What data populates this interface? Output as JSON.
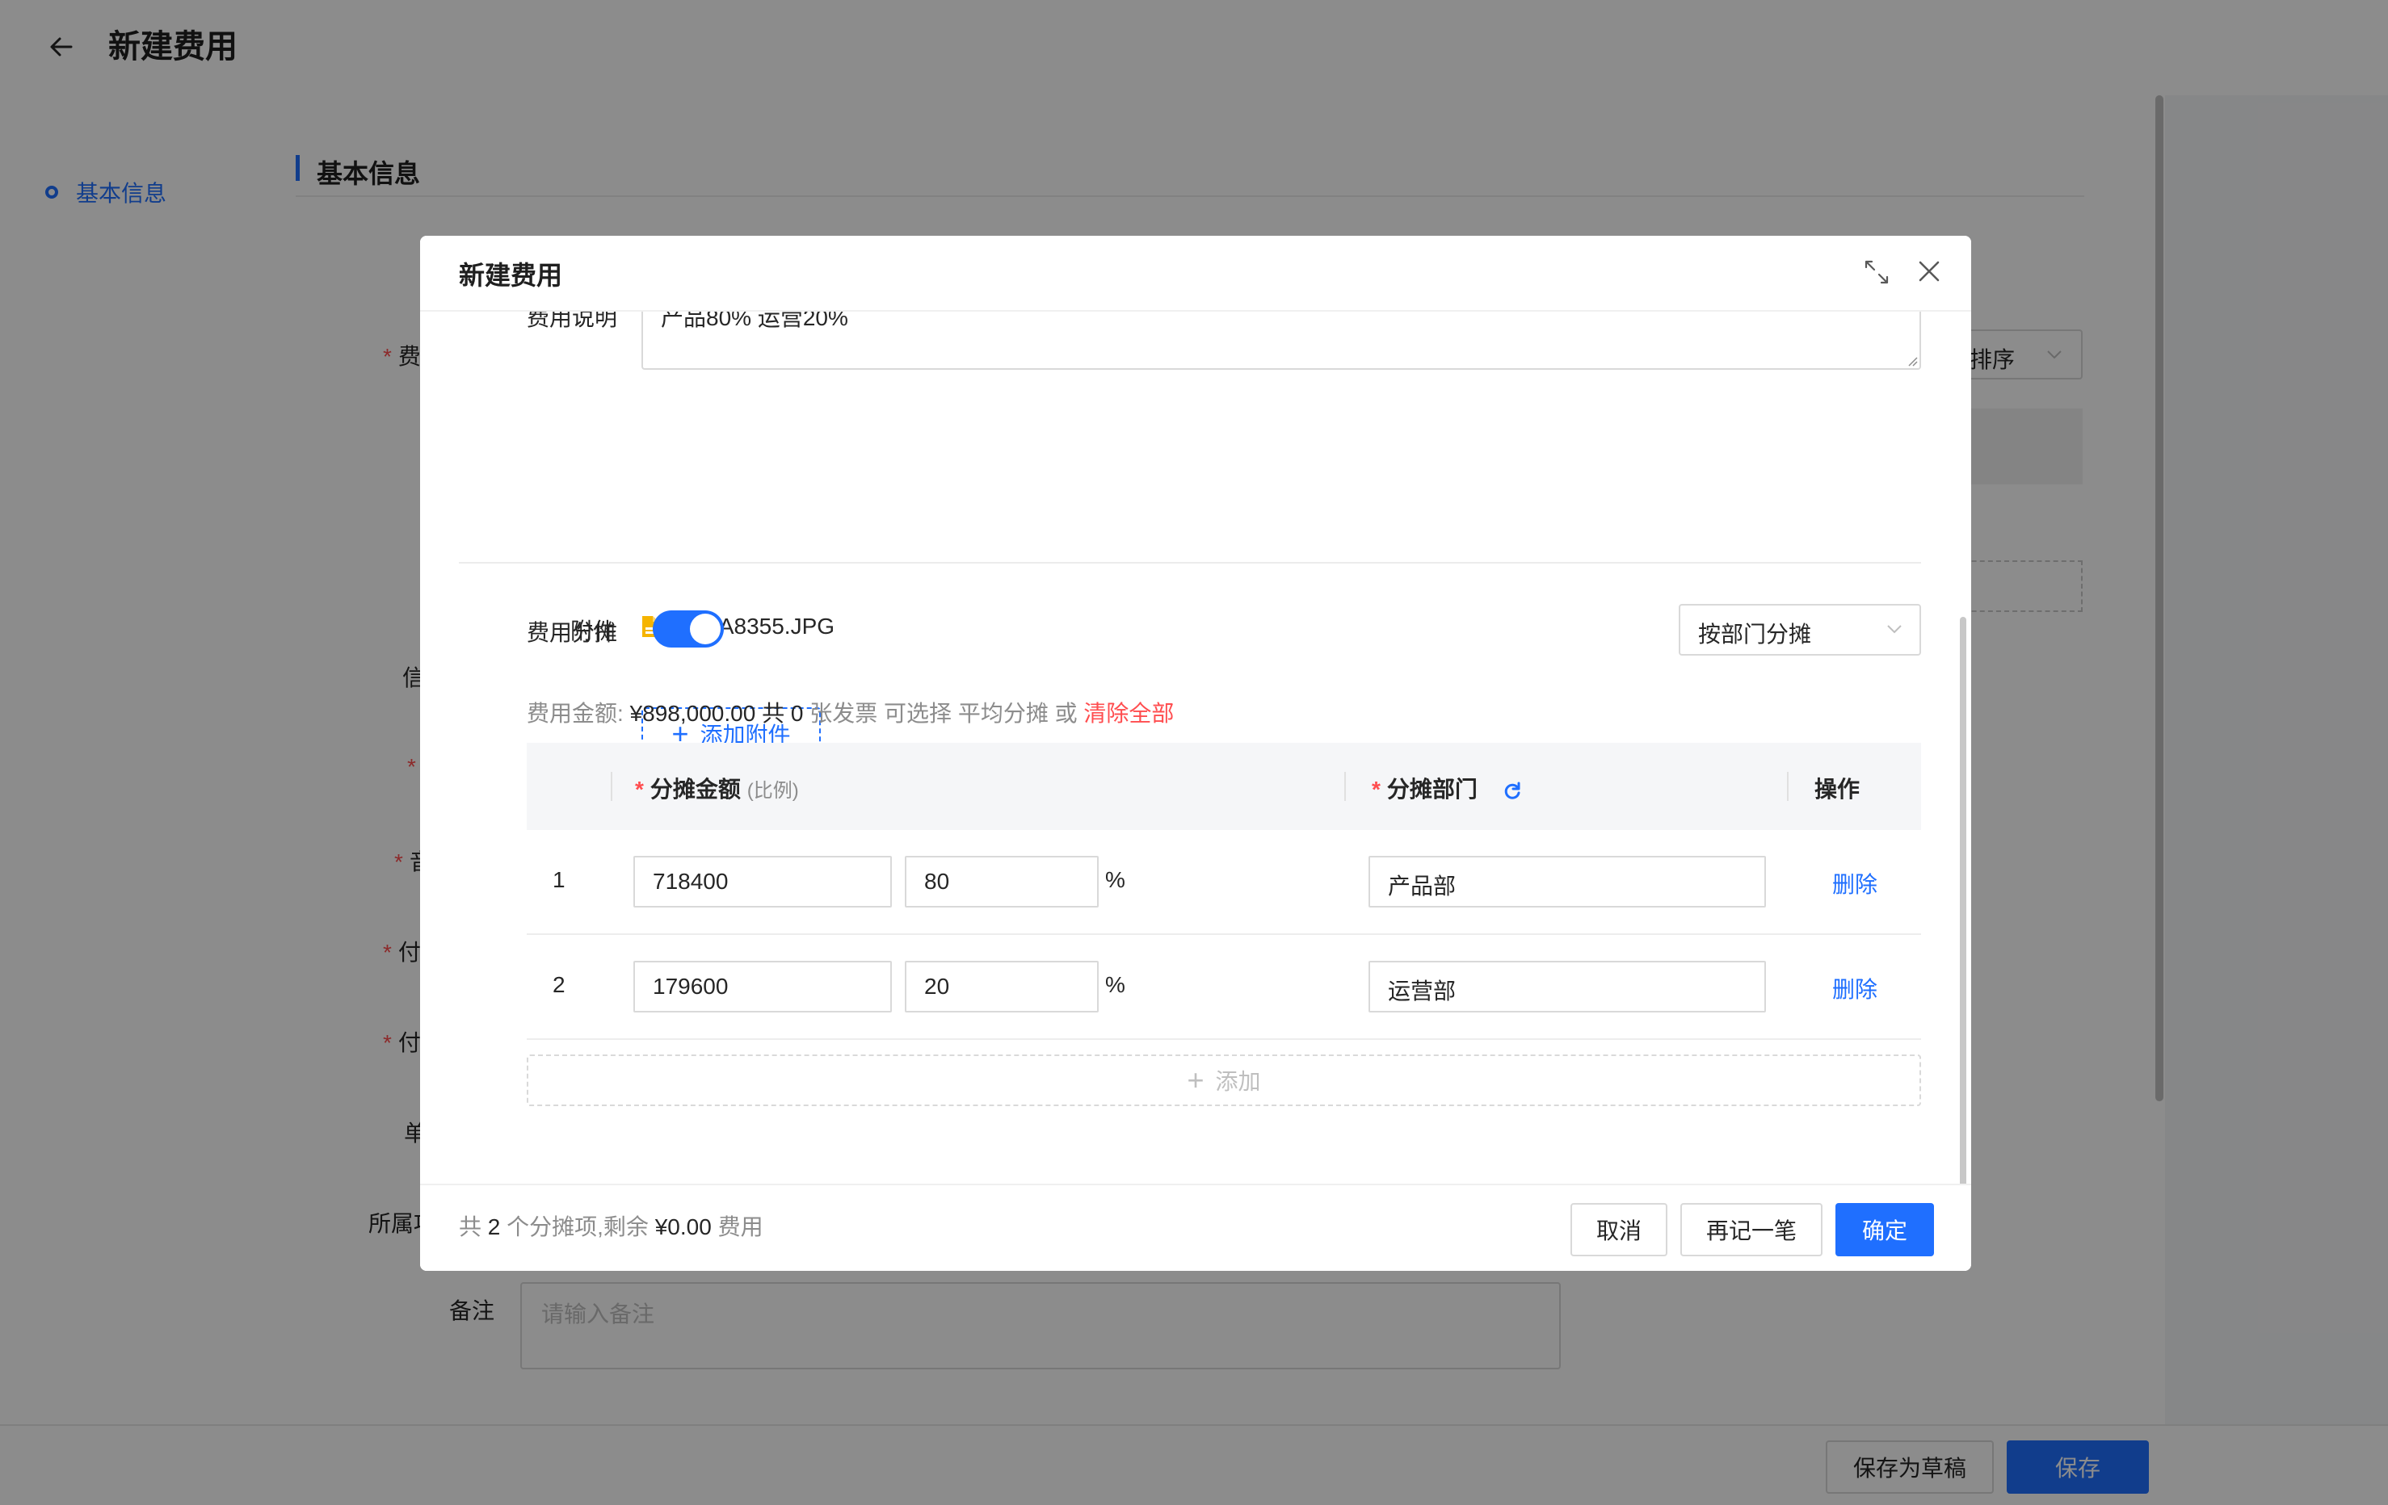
{
  "page": {
    "title": "新建费用",
    "nav_item": "基本信息",
    "section_title": "基本信息",
    "sort_select": "排序",
    "remark_label": "备注",
    "remark_placeholder": "请输入备注",
    "save_draft": "保存为草稿",
    "save": "保存",
    "partial_labels": {
      "fee_type": "费",
      "invoice": "信",
      "dept": "音",
      "pay1": "付",
      "pay2": "付",
      "unit": "单",
      "project": "所属项"
    }
  },
  "modal": {
    "title": "新建费用",
    "description_label": "费用说明",
    "description_value": "产品80% 运营20%",
    "attachment_label": "附件",
    "attachment_file": "3K1A8355.JPG",
    "add_attachment": "添加附件",
    "split_label": "费用分摊",
    "split_enabled": true,
    "split_method": "按部门分摊",
    "summary": {
      "amount_label": "费用金额:",
      "amount": "¥898,000.00",
      "invoice_prefix": "共",
      "invoice_count": "0",
      "invoice_suffix": "张发票",
      "can_choose": "可选择",
      "average_link": "平均分摊",
      "or": "或",
      "clear_all": "清除全部"
    },
    "table": {
      "col_amount": "分摊金额",
      "col_amount_sub": "(比例)",
      "col_dept": "分摊部门",
      "col_action": "操作",
      "rows": [
        {
          "index": "1",
          "amount": "718400",
          "ratio": "80",
          "unit": "%",
          "dept": "产品部",
          "action": "删除"
        },
        {
          "index": "2",
          "amount": "179600",
          "ratio": "20",
          "unit": "%",
          "dept": "运营部",
          "action": "删除"
        }
      ],
      "add_label": "添加"
    },
    "footer": {
      "prefix": "共",
      "count": "2",
      "middle": "个分摊项,剩余",
      "remaining": "¥0.00",
      "suffix": "费用",
      "cancel": "取消",
      "again": "再记一笔",
      "confirm": "确定"
    }
  },
  "colors": {
    "primary": "#1f6fff",
    "danger": "#ff4d4f",
    "muted": "#8c8c8c"
  }
}
